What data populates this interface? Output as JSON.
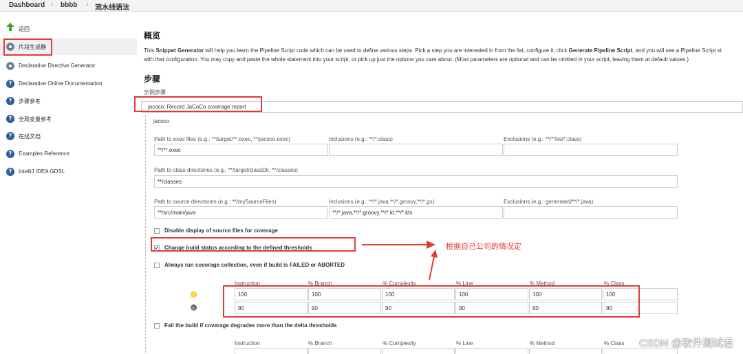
{
  "breadcrumb": [
    "Dashboard",
    "bbbb",
    "流水线语法"
  ],
  "sidebar": {
    "items": [
      {
        "label": "返回",
        "icon": "arrow-up-icon"
      },
      {
        "label": "片段生成器",
        "icon": "gear-icon"
      },
      {
        "label": "Declarative Directive Generator",
        "icon": "gear-icon"
      },
      {
        "label": "Declarative Online Documentation",
        "icon": "help-icon"
      },
      {
        "label": "步骤参考",
        "icon": "help-icon"
      },
      {
        "label": "全局变量参考",
        "icon": "help-icon"
      },
      {
        "label": "在线文档",
        "icon": "help-icon"
      },
      {
        "label": "Examples Reference",
        "icon": "help-icon"
      },
      {
        "label": "IntelliJ IDEA GDSL",
        "icon": "help-icon"
      }
    ]
  },
  "main": {
    "overview_title": "概览",
    "intro_p1": "This ",
    "intro_b1": "Snippet Generator",
    "intro_p2": " will help you learn the Pipeline Script code which can be used to define various steps. Pick a step you are interested in from the list, configure it, click ",
    "intro_b2": "Generate Pipeline Script",
    "intro_p3": ", and you will see a Pipeline Script st",
    "intro_line2": "with that configuration. You may copy and paste the whole statement into your script, or pick up just the options you care about. (Most parameters are optional and can be omitted in your script, leaving them at default values.)",
    "steps_title": "步骤",
    "sample_step_label": "示例步骤",
    "sample_step_value": "jacoco: Record JaCoCo coverage report",
    "section_title": "jacoco",
    "fields": {
      "exec_label": "Path to exec files (e.g.: **/target/**.exec, **/jacoco.exec)",
      "exec_value": "**/**.exec",
      "incl1_label": "Inclusions (e.g.: **/*.class)",
      "excl1_label": "Exclusions (e.g.: **/*Test*.class)",
      "classdir_label": "Path to class directories (e.g.: **/target/classDir, **/classes)",
      "classdir_value": "**/classes",
      "srcdir_label": "Path to source directories (e.g.: **/mySourceFiles)",
      "srcdir_value": "**/src/main/java",
      "incl2_label": "Inclusions (e.g.: **/*.java,**/*.groovy,**/*.gs)",
      "incl2_value": "**/*.java,**/*.groovy,**/*.kt,**/*.kts",
      "excl2_label": "Exclusions (e.g.: generated/**/*.java)"
    },
    "checkboxes": {
      "disable_source": "Disable display of source files for coverage",
      "change_build": "Change build status according to the defined thresholds",
      "always_run": "Always run coverage collection, even if build is FAILED or ABORTED",
      "fail_build": "Fail the build if coverage degrades more than the delta thresholds"
    },
    "threshold_headers": [
      "Instruction",
      "% Branch",
      "% Complexity",
      "% Line",
      "% Method",
      "% Class"
    ],
    "threshold_row1": [
      "100",
      "100",
      "100",
      "100",
      "100",
      "100"
    ],
    "threshold_row2": [
      "90",
      "90",
      "90",
      "90",
      "90",
      "90"
    ],
    "delta_headers": [
      "Instruction",
      "% Branch",
      "% Complexity",
      "% Line",
      "% Method",
      "% Class"
    ]
  },
  "annotation_note": "根据自己公司的情况定",
  "watermark": "CSDN @软件测试君",
  "colors": {
    "annotation": "#e53935",
    "help_icon": "#2e5f9c"
  }
}
